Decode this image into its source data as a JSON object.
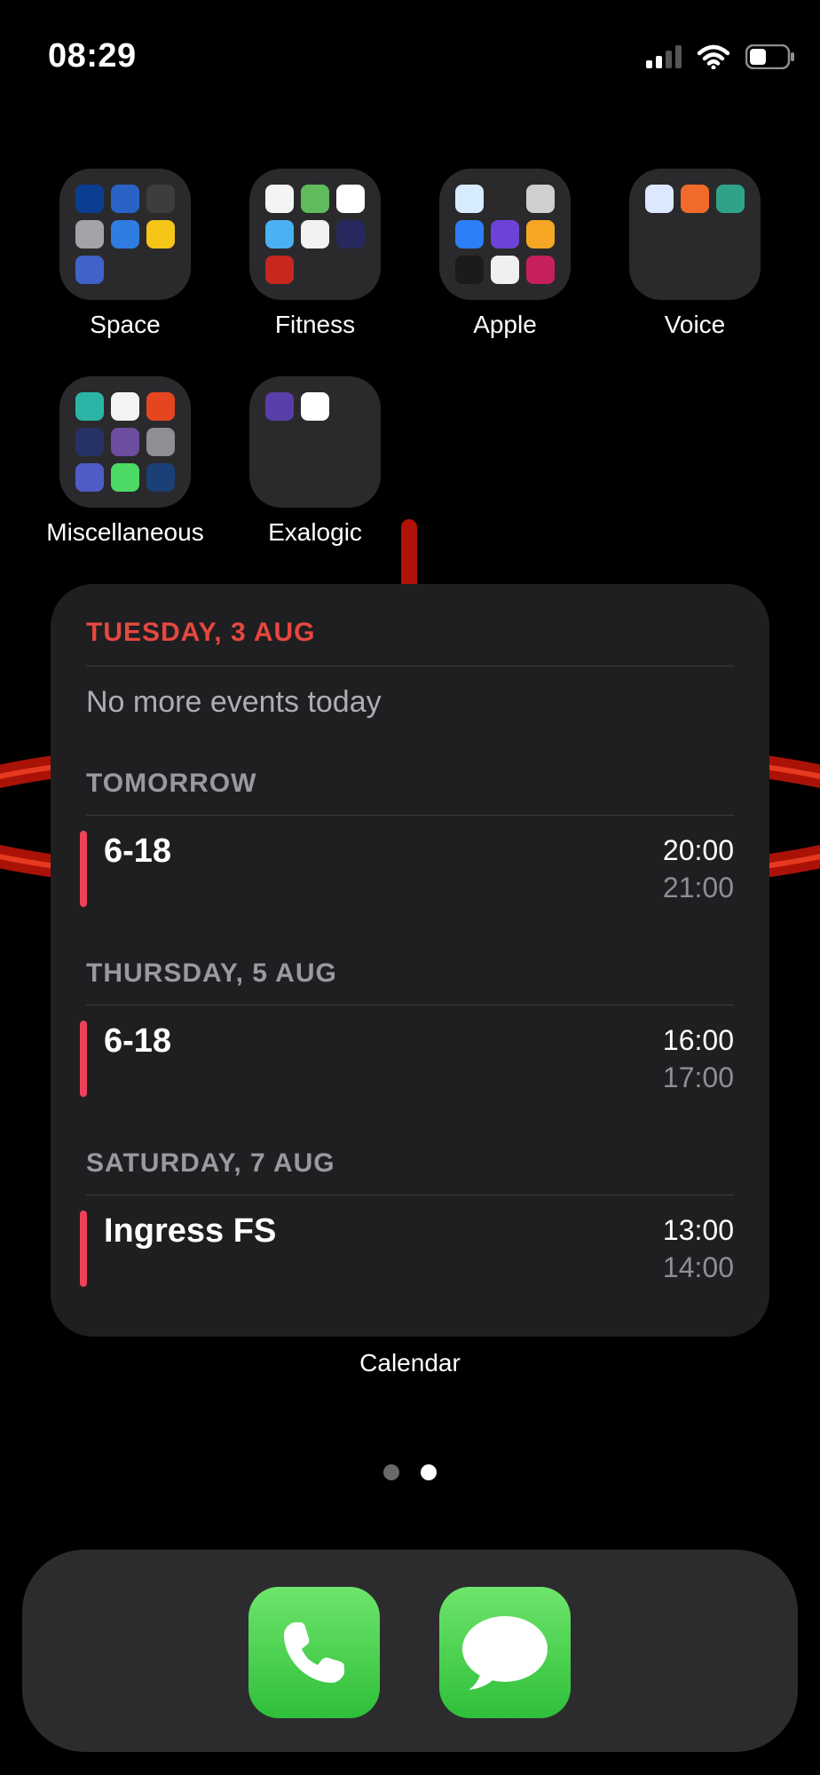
{
  "status": {
    "time": "08:29",
    "icons": [
      "cellular-signal-icon",
      "wifi-icon",
      "battery-icon"
    ]
  },
  "folders": [
    {
      "label": "Space",
      "app_colors": [
        "#0b3d91",
        "#2a63c6",
        "#3d3d40",
        "#a3a3a8",
        "#2f7de1",
        "#f5c518",
        "#3f63c9"
      ]
    },
    {
      "label": "Fitness",
      "app_colors": [
        "#f4f4f4",
        "#5fbb5c",
        "#ffffff",
        "#4ab1f2",
        "#f2f2f2",
        "#27295e",
        "#c7271d"
      ]
    },
    {
      "label": "Apple",
      "app_colors": [
        "#d8ecff",
        "#2b2b2b",
        "#cfcfcf",
        "#2d7ff9",
        "#6b44d7",
        "#f5a623",
        "#1b1b1b",
        "#f0f0f0",
        "#c51f5d"
      ]
    },
    {
      "label": "Voice",
      "app_colors": [
        "#dbe8ff",
        "#f26b2a",
        "#2fa38a"
      ]
    },
    {
      "label": "Miscellaneous",
      "app_colors": [
        "#2cb5a6",
        "#f3f3f3",
        "#e6461f",
        "#263266",
        "#6c4ea0",
        "#8e8e93",
        "#4f5cc8",
        "#4cd964",
        "#1b3f77"
      ]
    },
    {
      "label": "Exalogic",
      "app_colors": [
        "#5a3ea8",
        "#ffffff"
      ]
    }
  ],
  "calendar": {
    "today_header": "TUESDAY, 3 AUG",
    "no_events": "No more events today",
    "days": [
      {
        "header": "TOMORROW",
        "events": [
          {
            "title": "6-18",
            "start": "20:00",
            "end": "21:00"
          }
        ]
      },
      {
        "header": "THURSDAY, 5 AUG",
        "events": [
          {
            "title": "6-18",
            "start": "16:00",
            "end": "17:00"
          }
        ]
      },
      {
        "header": "SATURDAY, 7 AUG",
        "events": [
          {
            "title": "Ingress FS",
            "start": "13:00",
            "end": "14:00"
          }
        ]
      }
    ],
    "widget_label": "Calendar",
    "accent_color": "#e6483f",
    "event_color": "#f0405a"
  },
  "pages": {
    "count": 2,
    "current": 2
  },
  "dock": [
    "phone-app",
    "messages-app"
  ]
}
